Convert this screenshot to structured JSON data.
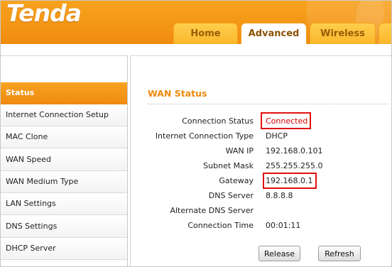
{
  "brand": {
    "logo_text": "Tenda",
    "accent_color": "#f39514",
    "highlight_color": "#e21010"
  },
  "tabs": [
    {
      "label": "Home",
      "active": false
    },
    {
      "label": "Advanced",
      "active": true
    },
    {
      "label": "Wireless",
      "active": false
    }
  ],
  "sidebar": {
    "items": [
      {
        "label": "Status",
        "active": true
      },
      {
        "label": "Internet Connection Setup",
        "active": false
      },
      {
        "label": "MAC Clone",
        "active": false
      },
      {
        "label": "WAN Speed",
        "active": false
      },
      {
        "label": "WAN Medium Type",
        "active": false
      },
      {
        "label": "LAN Settings",
        "active": false
      },
      {
        "label": "DNS Settings",
        "active": false
      },
      {
        "label": "DHCP Server",
        "active": false
      }
    ]
  },
  "main": {
    "title": "WAN Status",
    "rows": [
      {
        "label": "Connection Status",
        "value": "Connected",
        "highlighted": true
      },
      {
        "label": "Internet Connection Type",
        "value": "DHCP"
      },
      {
        "label": "WAN IP",
        "value": "192.168.0.101"
      },
      {
        "label": "Subnet Mask",
        "value": "255.255.255.0"
      },
      {
        "label": "Gateway",
        "value": "192.168.0.1",
        "highlighted": true
      },
      {
        "label": "DNS Server",
        "value": "8.8.8.8"
      },
      {
        "label": "Alternate DNS Server",
        "value": ""
      },
      {
        "label": "Connection Time",
        "value": "00:01:11"
      }
    ],
    "release_label": "Release",
    "refresh_label": "Refresh"
  }
}
